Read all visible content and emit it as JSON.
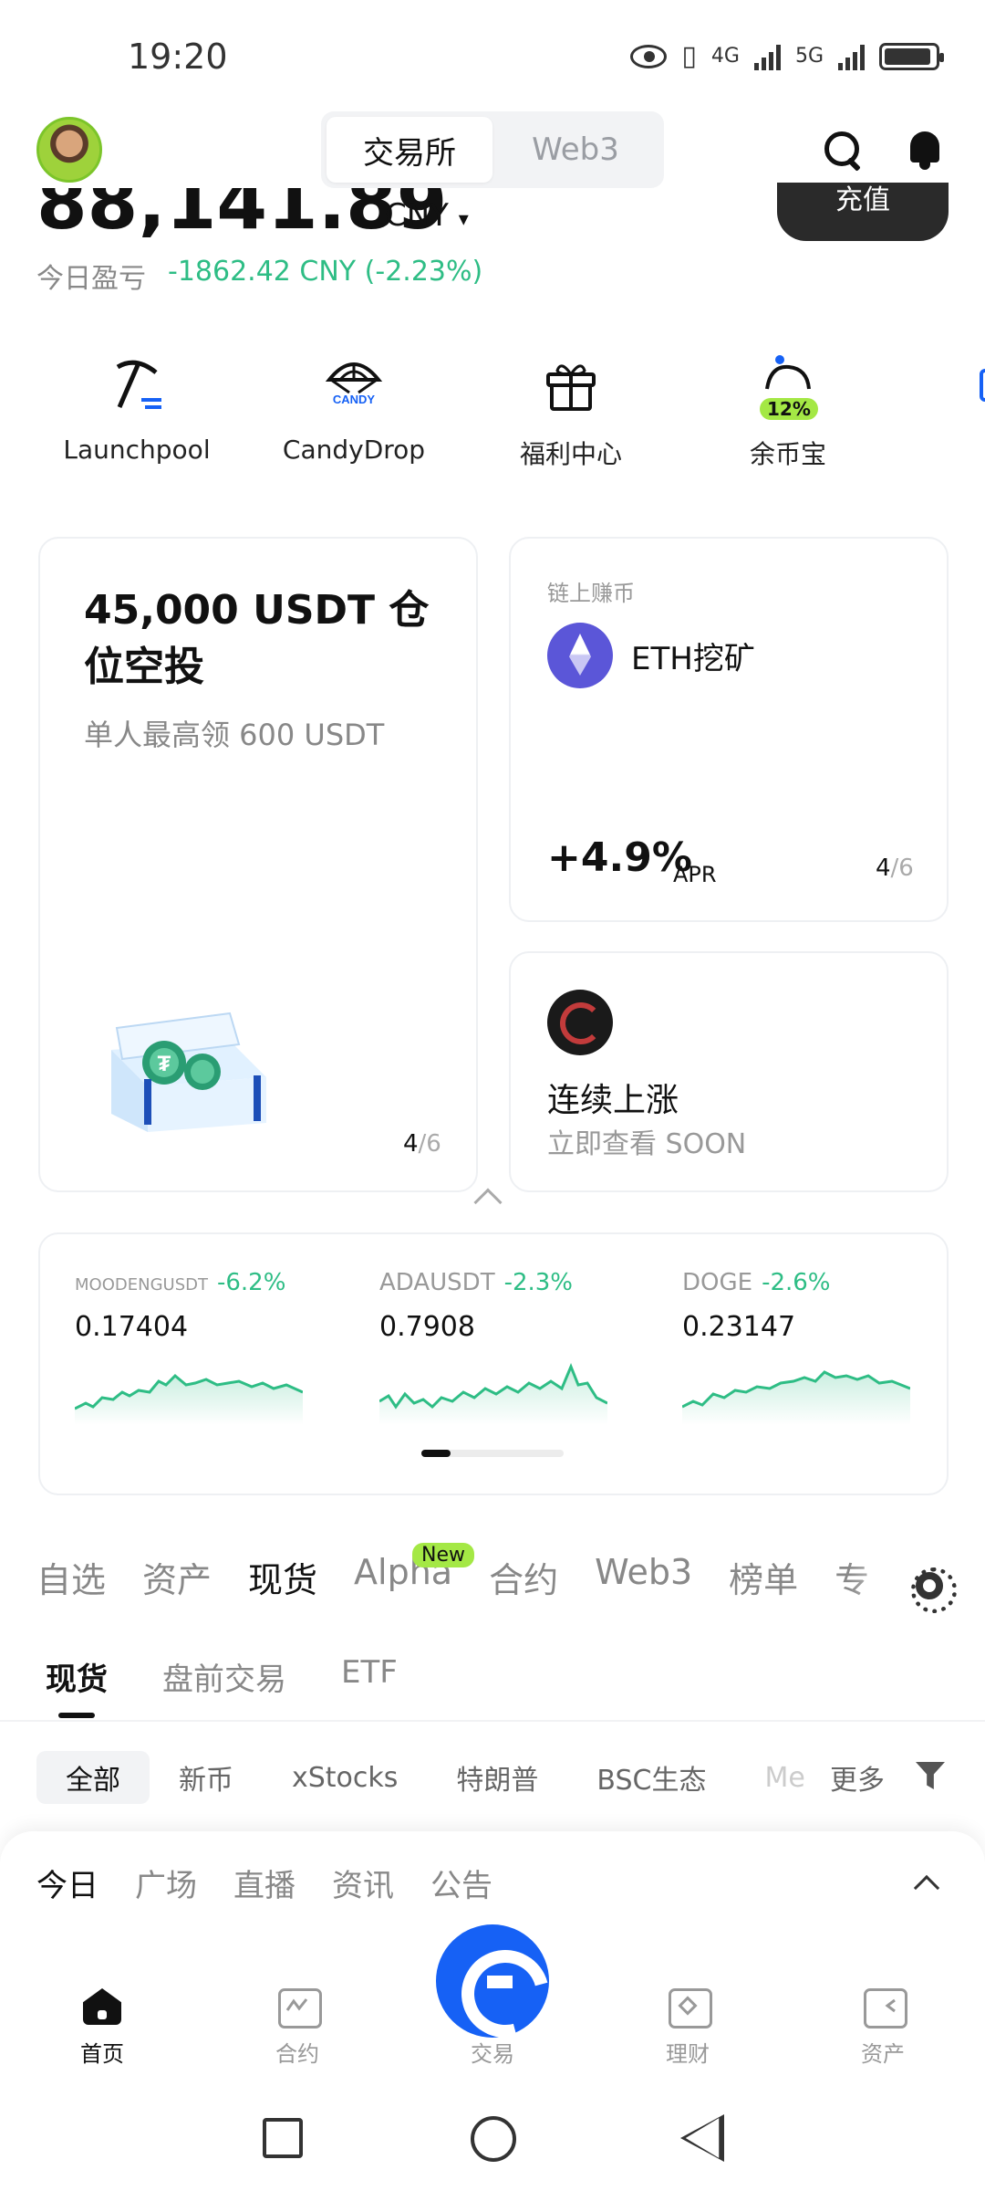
{
  "status_bar": {
    "time": "19:20",
    "net1": "4G",
    "net2": "5G"
  },
  "header": {
    "tabs": [
      {
        "label": "交易所",
        "active": true
      },
      {
        "label": "Web3",
        "active": false
      }
    ]
  },
  "balance": {
    "amount": "88,141.89",
    "currency": "CNY",
    "deposit_label": "充值",
    "pnl_label": "今日盈亏",
    "pnl_value": "-1862.42 CNY (-2.23%)"
  },
  "quick_entries": [
    {
      "label": "Launchpool",
      "icon": "pickaxe-icon"
    },
    {
      "label": "CandyDrop",
      "icon": "parachute-icon",
      "icon_text": "CANDY"
    },
    {
      "label": "福利中心",
      "icon": "gift-icon"
    },
    {
      "label": "余币宝",
      "icon": "saving-icon",
      "badge": "12%"
    }
  ],
  "promo_card": {
    "title": "45,000 USDT 仓位空投",
    "subtitle": "单人最高领 600 USDT",
    "page": "4",
    "page_total": "/6"
  },
  "eth_card": {
    "label": "链上赚币",
    "name": "ETH挖矿",
    "apr": "+4.9%",
    "apr_unit": "APR",
    "page": "4",
    "page_total": "/6"
  },
  "rise_card": {
    "title": "连续上涨",
    "subtitle": "立即查看 SOON"
  },
  "tickers": [
    {
      "symbol": "MOODENGUSDT",
      "change": "-6.2%",
      "price": "0.17404"
    },
    {
      "symbol": "ADAUSDT",
      "change": "-2.3%",
      "price": "0.7908"
    },
    {
      "symbol": "DOGE",
      "change": "-2.6%",
      "price": "0.23147"
    }
  ],
  "market_tabs": [
    {
      "label": "自选",
      "active": false
    },
    {
      "label": "资产",
      "active": false
    },
    {
      "label": "现货",
      "active": true
    },
    {
      "label": "Alpha",
      "active": false
    },
    {
      "label": "合约",
      "active": false
    },
    {
      "label": "Web3",
      "active": false
    },
    {
      "label": "榜单",
      "active": false
    },
    {
      "label": "专",
      "active": false
    }
  ],
  "new_badge": "New",
  "sub_tabs": [
    {
      "label": "现货",
      "active": true
    },
    {
      "label": "盘前交易",
      "active": false
    },
    {
      "label": "ETF",
      "active": false
    }
  ],
  "chips": [
    "全部",
    "新币",
    "xStocks",
    "特朗普",
    "BSC生态",
    "Me"
  ],
  "more_label": "更多",
  "news_tabs": [
    "今日",
    "广场",
    "直播",
    "资讯",
    "公告"
  ],
  "bottom_nav": [
    {
      "label": "首页",
      "active": true
    },
    {
      "label": "合约",
      "active": false
    },
    {
      "label": "交易",
      "active": false
    },
    {
      "label": "理财",
      "active": false
    },
    {
      "label": "资产",
      "active": false
    }
  ],
  "colors": {
    "accent": "#1661f5",
    "up_green": "#2ebd85",
    "badge_green": "#a4e845",
    "dark_btn": "#2a2a2a"
  }
}
